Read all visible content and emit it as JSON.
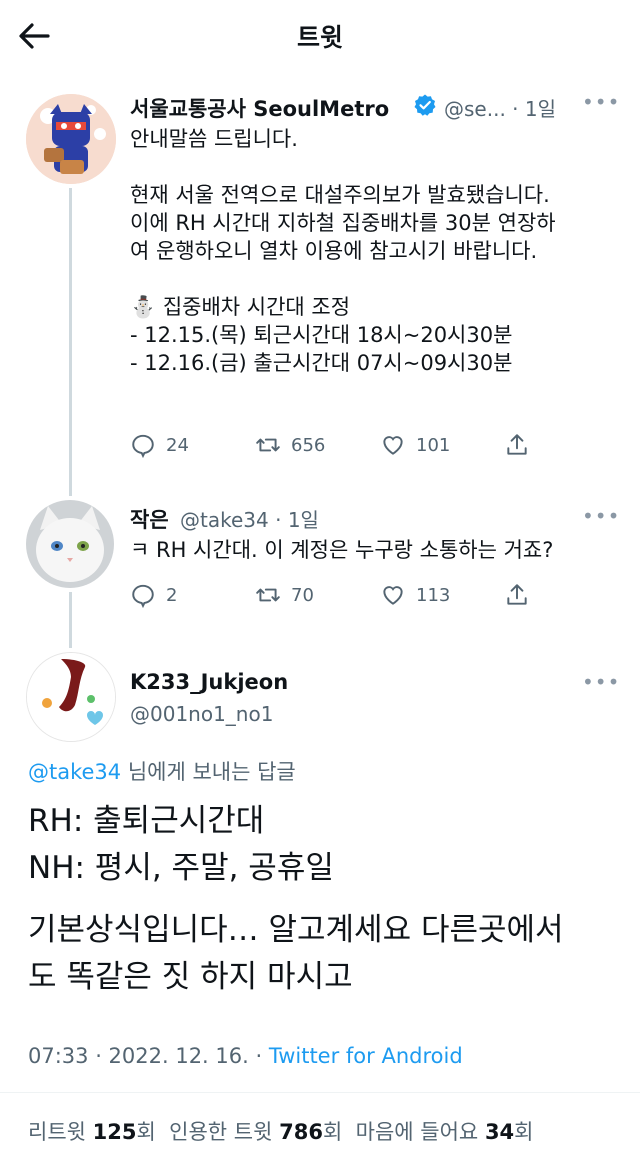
{
  "header": {
    "title": "트윗"
  },
  "tweets": [
    {
      "name": "서울교통공사 SeoulMetro",
      "verified": true,
      "handle": "@se...",
      "time": "1일",
      "text": "안내말씀 드립니다.\n\n현재 서울 전역으로 대설주의보가 발효됐습니다.\n이에 RH 시간대 지하철 집중배차를 30분 연장하\n여 운행하오니 열차 이용에 참고시기 바랍니다.\n\n⛄ 집중배차 시간대 조정\n- 12.15.(목) 퇴근시간대 18시~20시30분\n- 12.16.(금) 출근시간대 07시~09시30분",
      "replies": "24",
      "retweets": "656",
      "likes": "101"
    },
    {
      "name": "작은",
      "handle": "@take34",
      "time": "1일",
      "text": "ㅋ RH 시간대. 이 계정은 누구랑 소통하는 거죠?",
      "replies": "2",
      "retweets": "70",
      "likes": "113"
    }
  ],
  "main": {
    "name": "K233_Jukjeon",
    "handle": "@001no1_no1",
    "reply_mention": "@take34",
    "reply_suffix": " 님에게 보내는 답글",
    "lines": [
      "RH: 출퇴근시간대",
      "NH: 평시, 주말, 공휴일",
      "기본상식입니다… 알고계세요 다른곳에서",
      "도 똑같은 짓 하지 마시고"
    ],
    "time": "07:33 · 2022. 12. 16. · ",
    "source": "Twitter for Android"
  },
  "stats": {
    "retweet_label": "리트윗 ",
    "retweet_count": "125",
    "retweet_unit": "회",
    "quote_label": "인용한 트윗 ",
    "quote_count": "786",
    "quote_unit": "회",
    "like_label": "마음에 들어요 ",
    "like_count": "34",
    "like_unit": "회"
  },
  "colors": {
    "accent": "#1d9bf0",
    "text": "#0f1419",
    "muted": "#536471"
  }
}
